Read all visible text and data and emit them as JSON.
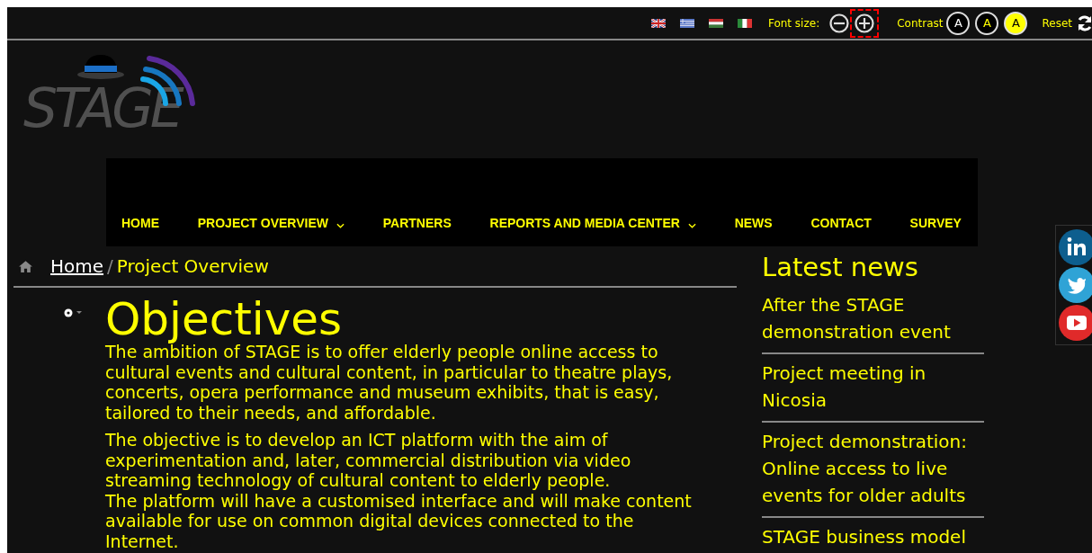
{
  "top_bar": {
    "languages": [
      {
        "kind": "uk"
      },
      {
        "kind": "greece"
      },
      {
        "kind": "hungary"
      },
      {
        "kind": "italy"
      }
    ],
    "font_size": {
      "label": "Font size:",
      "decrease_focused": false,
      "increase_focused": true
    },
    "contrast": {
      "label": "Contrast",
      "options": [
        {
          "kind": "white",
          "label": "A"
        },
        {
          "kind": "yellow",
          "label": "A"
        },
        {
          "kind": "inverse",
          "label": "A"
        }
      ]
    },
    "reset": {
      "label": "Reset"
    }
  },
  "logo": {
    "text": "STAGE"
  },
  "nav": [
    {
      "label": "HOME",
      "has_dropdown": false
    },
    {
      "label": "PROJECT OVERVIEW",
      "has_dropdown": true
    },
    {
      "label": "PARTNERS",
      "has_dropdown": false
    },
    {
      "label": "REPORTS AND MEDIA CENTER",
      "has_dropdown": true
    },
    {
      "label": "NEWS",
      "has_dropdown": false
    },
    {
      "label": "CONTACT",
      "has_dropdown": false
    },
    {
      "label": "SURVEY",
      "has_dropdown": false
    }
  ],
  "breadcrumb": {
    "home": "Home",
    "separator": "/",
    "current": "Project Overview"
  },
  "article": {
    "title": "Objectives",
    "paragraphs": [
      "The ambition of STAGE is to offer elderly people online access to cultural events and cultural content, in particular to theatre plays, concerts, opera performance and museum exhibits, that is easy, tailored to their needs, and affordable.",
      "The objective is to develop an ICT platform with the aim of experimentation and, later, commercial distribution via video streaming technology of cultural content to elderly people.",
      "The platform will have a customised interface and will make content available for use on common digital devices connected to the Internet."
    ]
  },
  "sidebar": {
    "title": "Latest news",
    "items": [
      "After the STAGE demonstration event",
      "Project meeting in Nicosia",
      "Project demonstration: Online access to live events for older adults",
      "STAGE business model"
    ]
  },
  "social": [
    {
      "kind": "linkedin"
    },
    {
      "kind": "twitter"
    },
    {
      "kind": "youtube"
    }
  ]
}
